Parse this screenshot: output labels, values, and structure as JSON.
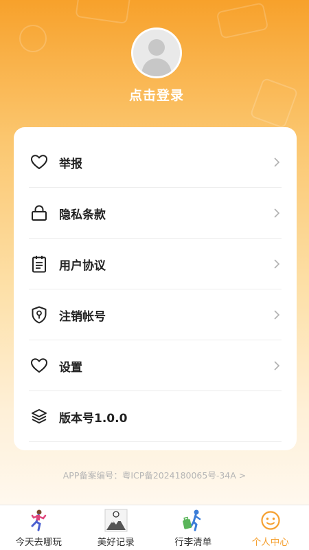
{
  "profile": {
    "login_label": "点击登录",
    "avatar_icon": "default-avatar-icon"
  },
  "menu": [
    {
      "label": "举报",
      "icon": "heart-icon",
      "chevron": true
    },
    {
      "label": "隐私条款",
      "icon": "lock-icon",
      "chevron": true
    },
    {
      "label": "用户协议",
      "icon": "notepad-icon",
      "chevron": true
    },
    {
      "label": "注销帐号",
      "icon": "shield-key-icon",
      "chevron": true
    },
    {
      "label": "设置",
      "icon": "heart-icon",
      "chevron": true
    },
    {
      "label": "版本号1.0.0",
      "icon": "layers-icon",
      "chevron": false
    }
  ],
  "footer": {
    "icp_text": "APP备案编号：粤ICP备2024180065号-34A >"
  },
  "tabbar": {
    "items": [
      {
        "label": "今天去哪玩",
        "icon": "running-person-icon",
        "active": false
      },
      {
        "label": "美好记录",
        "icon": "mountain-photo-icon",
        "active": false
      },
      {
        "label": "行李清单",
        "icon": "traveler-luggage-icon",
        "active": false
      },
      {
        "label": "个人中心",
        "icon": "smiley-face-icon",
        "active": true
      }
    ]
  },
  "colors": {
    "accent": "#f5a030",
    "header_top": "#f7a12b",
    "text": "#222222",
    "muted": "#b5b5b5"
  }
}
